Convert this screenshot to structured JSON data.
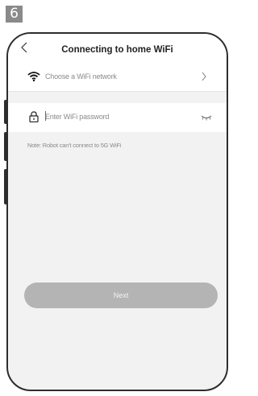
{
  "step": "6",
  "header": {
    "title": "Connecting to home WiFi",
    "back_icon": "chevron-left-icon"
  },
  "wifi_row": {
    "label": "Choose a WiFi network",
    "icon": "wifi-icon",
    "chevron": "chevron-right-icon"
  },
  "password_row": {
    "placeholder": "Enter WiFi password",
    "icon": "lock-icon",
    "toggle_icon": "eye-closed-icon"
  },
  "note": "Note: Robot can't connect to 5G WiFi",
  "next_button": {
    "label": "Next"
  },
  "colors": {
    "frame": "#2d2d2d",
    "background": "#f2f2f2",
    "button": "#b4b4b4",
    "muted_text": "#8a8a8a"
  }
}
